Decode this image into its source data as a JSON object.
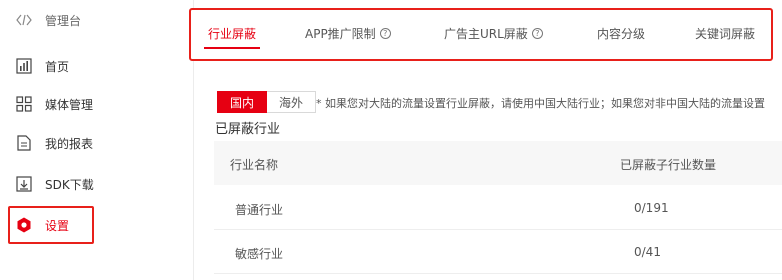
{
  "sidebar": {
    "items": [
      {
        "label": "管理台",
        "icon": "code-brackets-icon"
      },
      {
        "label": "首页",
        "icon": "bar-chart-icon"
      },
      {
        "label": "媒体管理",
        "icon": "grid-icon"
      },
      {
        "label": "我的报表",
        "icon": "document-icon"
      },
      {
        "label": "SDK下载",
        "icon": "download-icon"
      },
      {
        "label": "设置",
        "icon": "hexagon-gear-icon"
      }
    ]
  },
  "tabs": [
    {
      "label": "行业屏蔽",
      "help": false
    },
    {
      "label": "APP推广限制",
      "help": true
    },
    {
      "label": "广告主URL屏蔽",
      "help": true
    },
    {
      "label": "内容分级",
      "help": false
    },
    {
      "label": "关键词屏蔽",
      "help": false
    }
  ],
  "help_glyph": "?",
  "region": {
    "domestic": "国内",
    "overseas": "海外"
  },
  "note": "* 如果您对大陆的流量设置行业屏蔽，请使用中国大陆行业；如果您对非中国大陆的流量设置",
  "section_title": "已屏蔽行业",
  "table": {
    "headers": [
      "行业名称",
      "已屏蔽子行业数量"
    ],
    "rows": [
      [
        "普通行业",
        "0/191"
      ],
      [
        "敏感行业",
        "0/41"
      ]
    ]
  },
  "colors": {
    "accent": "#e60012",
    "highlight_border": "#e8201a"
  }
}
